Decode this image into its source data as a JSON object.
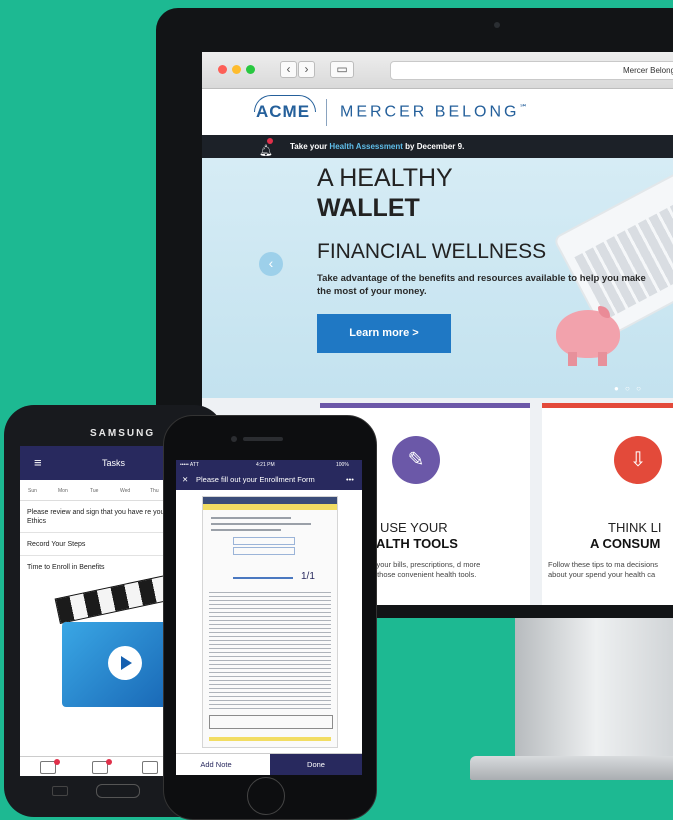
{
  "browser": {
    "tab_title": "Mercer Belong",
    "back_glyph": "‹",
    "forward_glyph": "›",
    "sidebar_glyph": "▭"
  },
  "site": {
    "logo_acme": "ACME",
    "brand": "MERCER BELONG",
    "brand_mark": "℠"
  },
  "alert": {
    "prefix": "Take your ",
    "link": "Health Assessment",
    "suffix": " by December 9."
  },
  "hero": {
    "line1": "A HEALTHY",
    "line2": "WALLET",
    "heading": "FINANCIAL WELLNESS",
    "body": "Take advantage of the benefits and resources available to help you make the most of your money.",
    "cta": "Learn more >",
    "prev_glyph": "‹",
    "dots": "● ○ ○"
  },
  "tiles": [
    {
      "line1": "USE YOUR",
      "line2": "HEALTH TOOLS",
      "body": "nage your bills, prescriptions, d more with those convenient health tools.",
      "color": "#6b58a8",
      "icon": "notepad-icon",
      "icon_glyph": "✎"
    },
    {
      "line1": "THINK LI",
      "line2": "A CONSUM",
      "body": "Follow these tips to ma decisions about your spend your health ca",
      "color": "#e34a3a",
      "icon": "download-icon",
      "icon_glyph": "⇩"
    }
  ],
  "samsung": {
    "brand": "SAMSUNG",
    "title": "Tasks",
    "menu_glyph": "≡",
    "days": [
      "Sun",
      "Mon",
      "Tue",
      "Wed",
      "Thu"
    ],
    "rows": [
      "Please review and sign that you have re your Code of Ethics",
      "Record Your Steps",
      "Time to Enroll in Benefits"
    ]
  },
  "iphone": {
    "status_left": "••••• ATT",
    "status_time": "4:21 PM",
    "status_right": "100%",
    "close_glyph": "✕",
    "nav_title": "Please fill out your Enrollment Form",
    "nav_more": "•••",
    "page_indicator": "1/1",
    "add_note": "Add Note",
    "done": "Done"
  },
  "colors": {
    "background": "#1db992",
    "brand_blue": "#25609b",
    "nav_purple": "#28295e",
    "cta_blue": "#1f78c4"
  }
}
